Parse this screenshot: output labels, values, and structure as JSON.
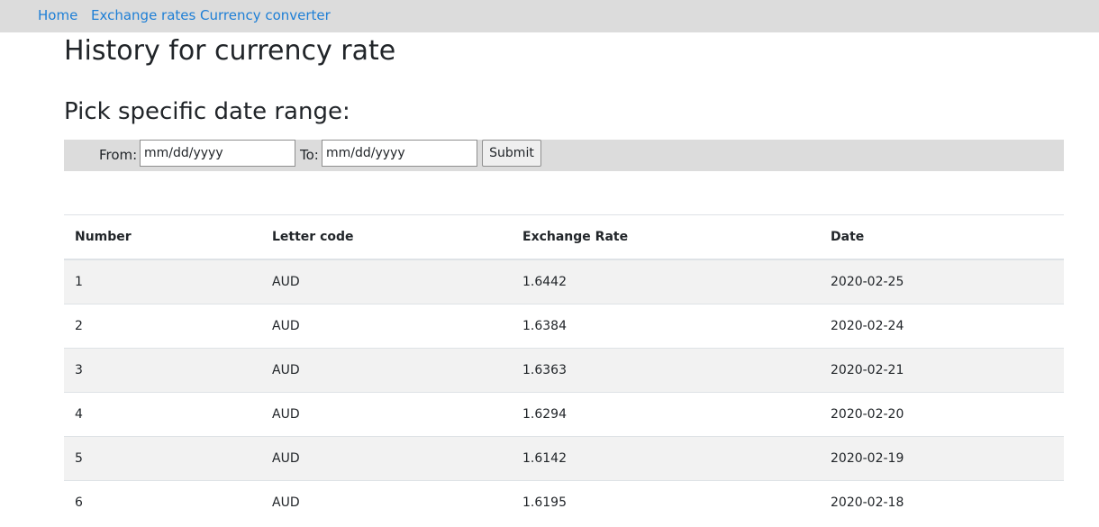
{
  "nav": {
    "links": [
      "Home",
      "Exchange rates",
      "Currency converter"
    ]
  },
  "page": {
    "title": "History for currency rate",
    "range_title": "Pick specific date range:"
  },
  "filter": {
    "from_label": "From:",
    "from_placeholder": "mm/dd/yyyy",
    "to_label": "To:",
    "to_placeholder": "mm/dd/yyyy",
    "submit_label": "Submit"
  },
  "table": {
    "headers": [
      "Number",
      "Letter code",
      "Exchange Rate",
      "Date"
    ],
    "rows": [
      [
        "1",
        "AUD",
        "1.6442",
        "2020-02-25"
      ],
      [
        "2",
        "AUD",
        "1.6384",
        "2020-02-24"
      ],
      [
        "3",
        "AUD",
        "1.6363",
        "2020-02-21"
      ],
      [
        "4",
        "AUD",
        "1.6294",
        "2020-02-20"
      ],
      [
        "5",
        "AUD",
        "1.6142",
        "2020-02-19"
      ],
      [
        "6",
        "AUD",
        "1.6195",
        "2020-02-18"
      ]
    ]
  },
  "colors": {
    "link": "#1e7fd6",
    "navbar_bg": "#dcdcdc",
    "stripe_bg": "#f2f2f2"
  }
}
